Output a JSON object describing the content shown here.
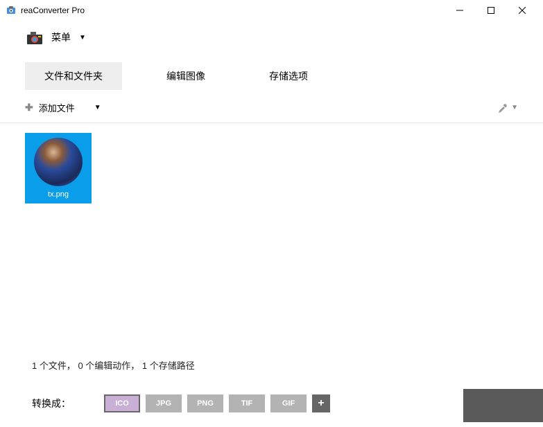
{
  "titlebar": {
    "title": "reaConverter Pro"
  },
  "menu": {
    "label": "菜单"
  },
  "tabs": {
    "files": "文件和文件夹",
    "edit": "编辑图像",
    "storage": "存储选项"
  },
  "toolbar": {
    "add_file": "添加文件"
  },
  "files": [
    {
      "name": "tx.png"
    }
  ],
  "status": "1 个文件，  0 个编辑动作，  1 个存储路径",
  "convert": {
    "label": "转换成：",
    "formats": [
      "ICO",
      "JPG",
      "PNG",
      "TIF",
      "GIF"
    ],
    "selected": "ICO"
  }
}
